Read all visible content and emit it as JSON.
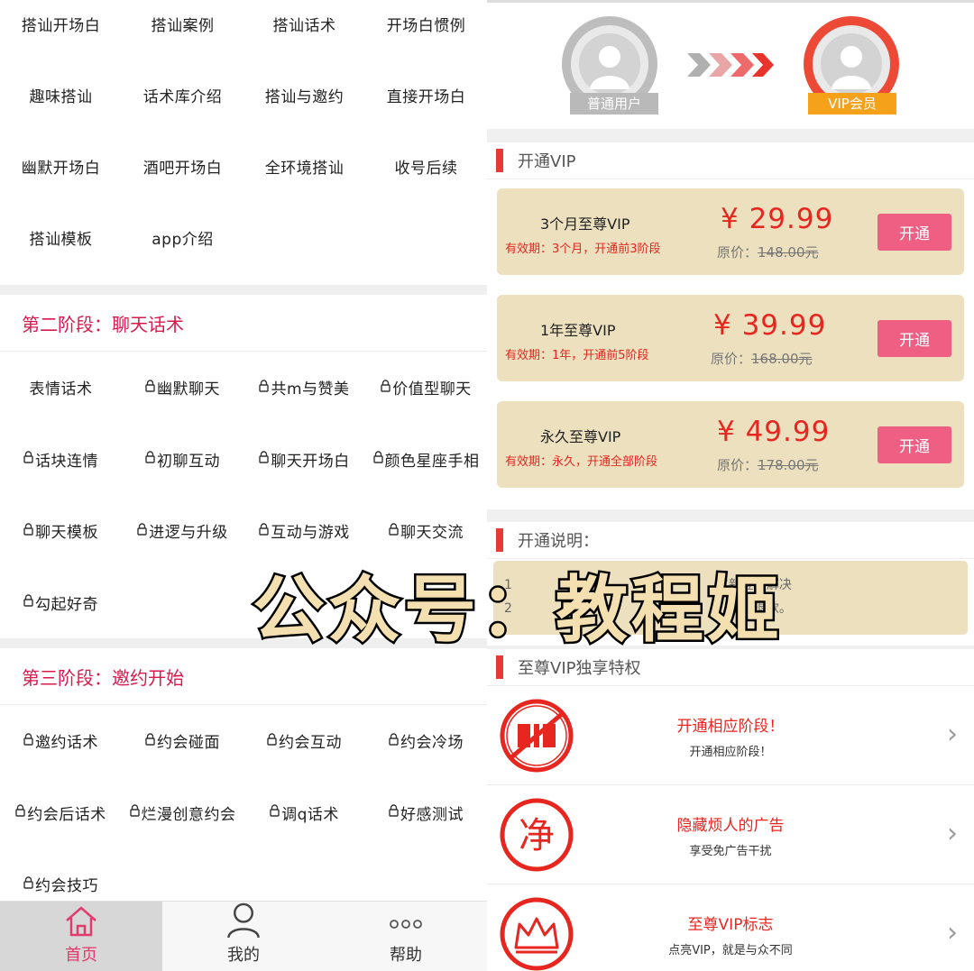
{
  "stage1": {
    "items": [
      "搭讪开场白",
      "搭讪案例",
      "搭讪话术",
      "开场白惯例",
      "趣味搭讪",
      "话术库介绍",
      "搭讪与邀约",
      "直接开场白",
      "幽默开场白",
      "酒吧开场白",
      "全环境搭讪",
      "收号后续",
      "搭讪模板",
      "app介绍"
    ]
  },
  "stage2": {
    "title": "第二阶段：聊天话术",
    "items": [
      {
        "label": "表情话术",
        "locked": false
      },
      {
        "label": "幽默聊天",
        "locked": true
      },
      {
        "label": "共m与赞美",
        "locked": true
      },
      {
        "label": "价值型聊天",
        "locked": true
      },
      {
        "label": "话块连情",
        "locked": true
      },
      {
        "label": "初聊互动",
        "locked": true
      },
      {
        "label": "聊天开场白",
        "locked": true
      },
      {
        "label": "颜色星座手相",
        "locked": true
      },
      {
        "label": "聊天模板",
        "locked": true
      },
      {
        "label": "进逻与升级",
        "locked": true
      },
      {
        "label": "互动与游戏",
        "locked": true
      },
      {
        "label": "聊天交流",
        "locked": true
      },
      {
        "label": "勾起好奇",
        "locked": true
      }
    ]
  },
  "stage3": {
    "title": "第三阶段：邀约开始",
    "items": [
      {
        "label": "邀约话术",
        "locked": true
      },
      {
        "label": "约会碰面",
        "locked": true
      },
      {
        "label": "约会互动",
        "locked": true
      },
      {
        "label": "约会冷场",
        "locked": true
      },
      {
        "label": "约会后话术",
        "locked": true
      },
      {
        "label": "烂漫创意约会",
        "locked": true
      },
      {
        "label": "调q话术",
        "locked": true
      },
      {
        "label": "好感测试",
        "locked": true
      },
      {
        "label": "约会技巧",
        "locked": true
      }
    ]
  },
  "tabbar": {
    "home": "首页",
    "mine": "我的",
    "help": "帮助"
  },
  "hero": {
    "normal_label": "普通用户",
    "vip_label": "VIP会员"
  },
  "vip": {
    "section_title": "开通VIP",
    "plans": [
      {
        "name": "3个月至尊VIP",
        "note": "有效期：3个月，开通前3阶段",
        "price": "¥ 29.99",
        "orig_prefix": "原价：",
        "orig": "148.00元",
        "button": "开通"
      },
      {
        "name": "1年至尊VIP",
        "note": "有效期：1年，开通前5阶段",
        "price": "¥ 39.99",
        "orig_prefix": "原价：",
        "orig": "168.00元",
        "button": "开通"
      },
      {
        "name": "永久至尊VIP",
        "note": "有效期：永久，开通全部阶段",
        "price": "¥ 49.99",
        "orig_prefix": "原价：",
        "orig": "178.00元",
        "button": "开通"
      }
    ]
  },
  "notes": {
    "title": "开通说明：",
    "line1": "1",
    "line1_tail": "重新登陆解决",
    "line2": "2",
    "line2_tail": "概不退款。"
  },
  "perks": {
    "section_title": "至尊VIP独享特权",
    "items": [
      {
        "title": "开通相应阶段！",
        "desc": "开通相应阶段！"
      },
      {
        "title": "隐藏烦人的广告",
        "desc": "享受免广告干扰",
        "glyph": "净"
      },
      {
        "title": "至尊VIP标志",
        "desc": "点亮VIP，就是与众不同"
      }
    ]
  },
  "watermark": "公众号：教程姬",
  "colors": {
    "accent": "#e23a6c",
    "price": "#e6261f",
    "card": "#ede0bf",
    "button": "#ef5e83",
    "vip_ribbon": "#f5a11a"
  }
}
